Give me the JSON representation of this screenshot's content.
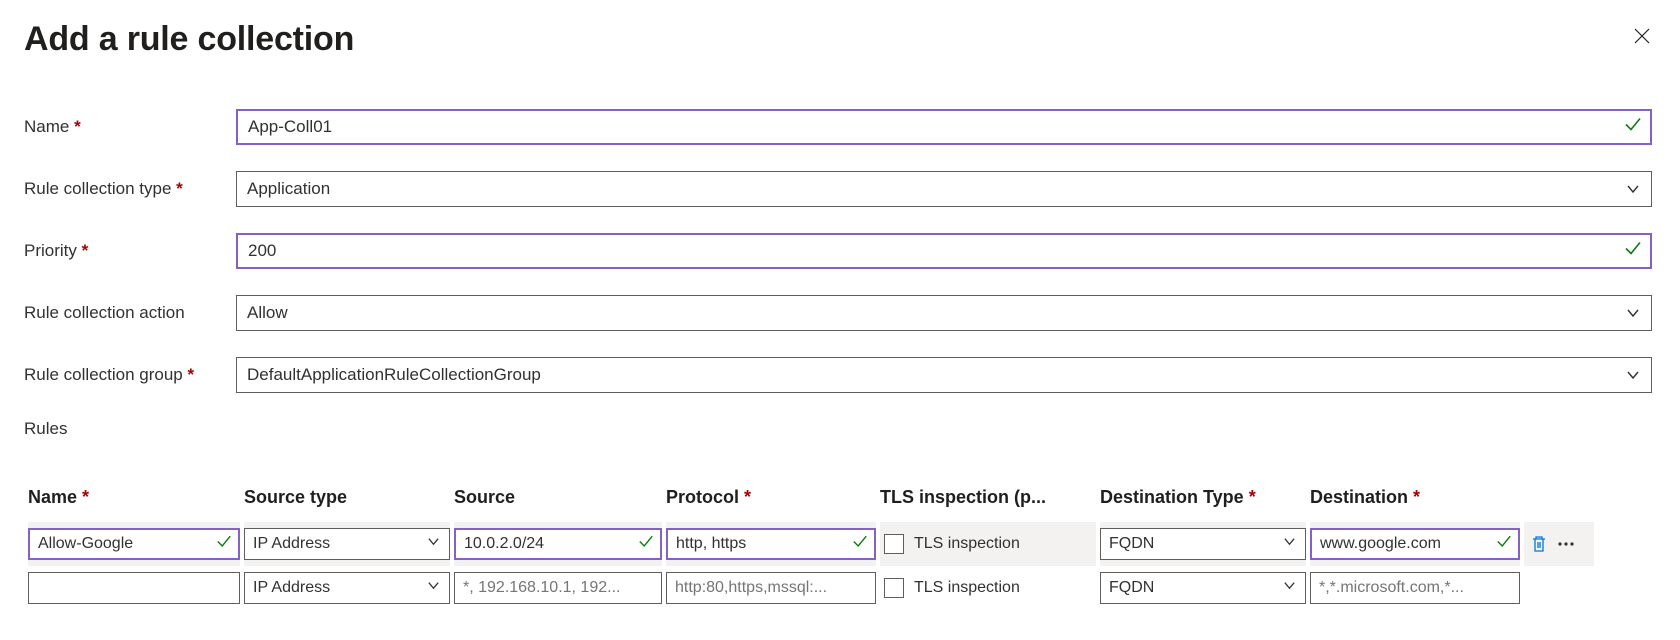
{
  "title": "Add a rule collection",
  "labels": {
    "name": "Name",
    "type": "Rule collection type",
    "priority": "Priority",
    "action": "Rule collection action",
    "group": "Rule collection group",
    "rules": "Rules"
  },
  "required": {
    "name": true,
    "type": true,
    "priority": true,
    "action": false,
    "group": true
  },
  "fields": {
    "name": "App-Coll01",
    "type": "Application",
    "priority": "200",
    "action": "Allow",
    "group": "DefaultApplicationRuleCollectionGroup"
  },
  "table": {
    "headers": {
      "name": "Name",
      "source_type": "Source type",
      "source": "Source",
      "protocol": "Protocol",
      "tls": "TLS inspection (p...",
      "dest_type": "Destination Type",
      "dest": "Destination"
    },
    "required": {
      "name": true,
      "source_type": false,
      "source": false,
      "protocol": true,
      "tls": false,
      "dest_type": true,
      "dest": true
    },
    "rows": [
      {
        "name": "Allow-Google",
        "source_type": "IP Address",
        "source": "10.0.2.0/24",
        "protocol": "http, https",
        "tls_label": "TLS inspection",
        "tls_checked": false,
        "dest_type": "FQDN",
        "dest": "www.google.com",
        "validated": true,
        "actions": true
      },
      {
        "name": "",
        "source_type": "IP Address",
        "source": "",
        "source_placeholder": "*, 192.168.10.1, 192...",
        "protocol": "",
        "protocol_placeholder": "http:80,https,mssql:...",
        "tls_label": "TLS inspection",
        "tls_checked": false,
        "dest_type": "FQDN",
        "dest": "",
        "dest_placeholder": "*,*.microsoft.com,*...",
        "validated": false,
        "actions": false
      }
    ]
  }
}
